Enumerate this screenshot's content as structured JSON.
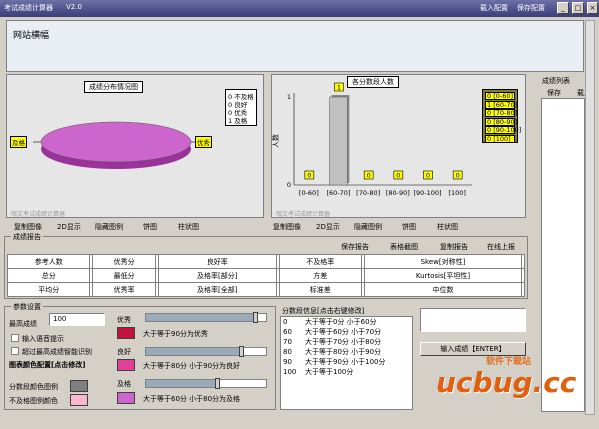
{
  "title": {
    "app": "考试成绩计算器",
    "version": "V2.0",
    "menu_load": "载入配置",
    "menu_save": "保存配置"
  },
  "banner": {
    "text": "网站横幅"
  },
  "pie": {
    "title": "成绩分布情况图",
    "left_label": "及格",
    "right_label": "优秀",
    "watermark": "嗡文考试成绩计算器",
    "legend": [
      {
        "text": "0 不及格"
      },
      {
        "text": "0 良好"
      },
      {
        "text": "0 优秀"
      },
      {
        "text": "1 及格"
      }
    ],
    "colors": {
      "fill": "#cc66cc",
      "legend_bg": "#ffffff"
    }
  },
  "bar": {
    "title": "各分数段人数",
    "ylabel": "人数",
    "watermark": "嗡文考试成绩计算器",
    "legend": [
      "0 [0-60]",
      "1 [60-70]",
      "0 [70-80]",
      "0 [80-90]",
      "0 [90-100]",
      "0 [100]"
    ]
  },
  "chart_data": {
    "type": "bar",
    "title": "各分数段人数",
    "ylabel": "人数",
    "categories": [
      "[0-60]",
      "[60-70]",
      "[70-80]",
      "[80-90]",
      "[90-100]",
      "[100]"
    ],
    "values": [
      0,
      1,
      0,
      0,
      0,
      0
    ],
    "ylim": [
      0,
      1
    ]
  },
  "left_toolbar": [
    "复制图像",
    "2D显示",
    "隐藏图例",
    "饼图",
    "柱状图"
  ],
  "right_toolbar": [
    "复制图像",
    "2D显示",
    "隐藏图例",
    "饼图",
    "柱状图"
  ],
  "report": {
    "title": "成绩报告",
    "actions": [
      "保存报告",
      "表格截图",
      "复制报告",
      "在线上报"
    ],
    "rows": [
      [
        "参考人数",
        "",
        "优秀分",
        "",
        "良好率",
        "",
        "不及格率",
        "",
        "Skew[对称性]",
        ""
      ],
      [
        "总分",
        "",
        "最低分",
        "",
        "及格率[部分]",
        "",
        "方差",
        "",
        "Kurtosis[平坦性]",
        ""
      ],
      [
        "平均分",
        "",
        "优秀率",
        "",
        "及格率[全部]",
        "",
        "标准差",
        "",
        "中位数",
        ""
      ]
    ]
  },
  "params": {
    "title": "参数设置",
    "max_label": "最高成绩",
    "max_value": "100",
    "voice": "输入语音提示",
    "smart": "超过最高成绩智能识别",
    "color_cfg": "图表颜色配置[点击修改]",
    "seg_color": "分数段颜色图例",
    "fail_color": "不及格图例颜色",
    "grades": [
      {
        "name": "优秀",
        "desc": "大于等于90分为优秀",
        "color": "#c0143c",
        "level": 0.92
      },
      {
        "name": "良好",
        "desc": "大于等于80分 小于90分为良好",
        "color": "#e0409a",
        "level": 0.8
      },
      {
        "name": "及格",
        "desc": "大于等于60分 小于80分为及格",
        "color": "#cc66cc",
        "level": 0.6
      }
    ],
    "seg_swatch": "#808080",
    "fail_swatch": "#ffb6d0"
  },
  "segments": {
    "title": "分数段信息[点击右键修改]",
    "rows": [
      [
        "0",
        "大于等于0分 小于60分"
      ],
      [
        "60",
        "大于等于60分 小于70分"
      ],
      [
        "70",
        "大于等于70分 小于80分"
      ],
      [
        "80",
        "大于等于80分 小于90分"
      ],
      [
        "90",
        "大于等于90分 小于100分"
      ],
      [
        "100",
        "大于等于100分"
      ]
    ]
  },
  "input_btn": "输入成绩【ENTER】",
  "sidebar": {
    "title": "成绩列表",
    "save": "保存",
    "load": "载入"
  },
  "watermark": {
    "brand": "软件下载站",
    "logo": "ucbug.cc"
  }
}
